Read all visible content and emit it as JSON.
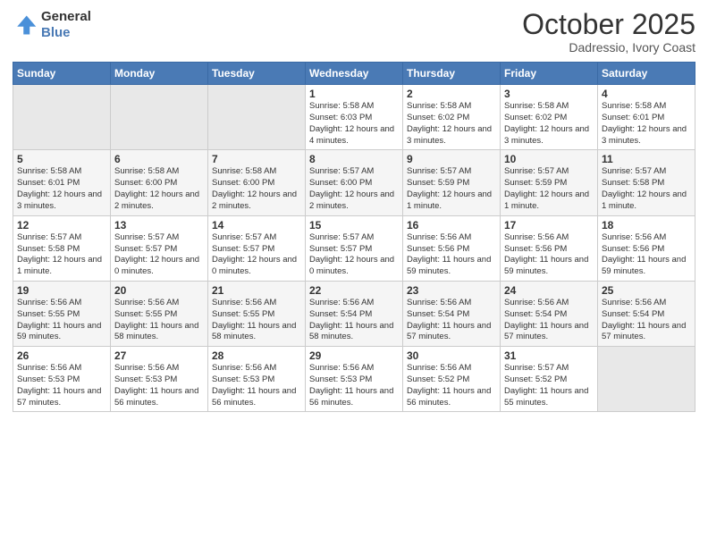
{
  "logo": {
    "line1": "General",
    "line2": "Blue"
  },
  "header": {
    "title": "October 2025",
    "subtitle": "Dadressio, Ivory Coast"
  },
  "weekdays": [
    "Sunday",
    "Monday",
    "Tuesday",
    "Wednesday",
    "Thursday",
    "Friday",
    "Saturday"
  ],
  "weeks": [
    [
      {
        "num": "",
        "info": ""
      },
      {
        "num": "",
        "info": ""
      },
      {
        "num": "",
        "info": ""
      },
      {
        "num": "1",
        "info": "Sunrise: 5:58 AM\nSunset: 6:03 PM\nDaylight: 12 hours and 4 minutes."
      },
      {
        "num": "2",
        "info": "Sunrise: 5:58 AM\nSunset: 6:02 PM\nDaylight: 12 hours and 3 minutes."
      },
      {
        "num": "3",
        "info": "Sunrise: 5:58 AM\nSunset: 6:02 PM\nDaylight: 12 hours and 3 minutes."
      },
      {
        "num": "4",
        "info": "Sunrise: 5:58 AM\nSunset: 6:01 PM\nDaylight: 12 hours and 3 minutes."
      }
    ],
    [
      {
        "num": "5",
        "info": "Sunrise: 5:58 AM\nSunset: 6:01 PM\nDaylight: 12 hours and 3 minutes."
      },
      {
        "num": "6",
        "info": "Sunrise: 5:58 AM\nSunset: 6:00 PM\nDaylight: 12 hours and 2 minutes."
      },
      {
        "num": "7",
        "info": "Sunrise: 5:58 AM\nSunset: 6:00 PM\nDaylight: 12 hours and 2 minutes."
      },
      {
        "num": "8",
        "info": "Sunrise: 5:57 AM\nSunset: 6:00 PM\nDaylight: 12 hours and 2 minutes."
      },
      {
        "num": "9",
        "info": "Sunrise: 5:57 AM\nSunset: 5:59 PM\nDaylight: 12 hours and 1 minute."
      },
      {
        "num": "10",
        "info": "Sunrise: 5:57 AM\nSunset: 5:59 PM\nDaylight: 12 hours and 1 minute."
      },
      {
        "num": "11",
        "info": "Sunrise: 5:57 AM\nSunset: 5:58 PM\nDaylight: 12 hours and 1 minute."
      }
    ],
    [
      {
        "num": "12",
        "info": "Sunrise: 5:57 AM\nSunset: 5:58 PM\nDaylight: 12 hours and 1 minute."
      },
      {
        "num": "13",
        "info": "Sunrise: 5:57 AM\nSunset: 5:57 PM\nDaylight: 12 hours and 0 minutes."
      },
      {
        "num": "14",
        "info": "Sunrise: 5:57 AM\nSunset: 5:57 PM\nDaylight: 12 hours and 0 minutes."
      },
      {
        "num": "15",
        "info": "Sunrise: 5:57 AM\nSunset: 5:57 PM\nDaylight: 12 hours and 0 minutes."
      },
      {
        "num": "16",
        "info": "Sunrise: 5:56 AM\nSunset: 5:56 PM\nDaylight: 11 hours and 59 minutes."
      },
      {
        "num": "17",
        "info": "Sunrise: 5:56 AM\nSunset: 5:56 PM\nDaylight: 11 hours and 59 minutes."
      },
      {
        "num": "18",
        "info": "Sunrise: 5:56 AM\nSunset: 5:56 PM\nDaylight: 11 hours and 59 minutes."
      }
    ],
    [
      {
        "num": "19",
        "info": "Sunrise: 5:56 AM\nSunset: 5:55 PM\nDaylight: 11 hours and 59 minutes."
      },
      {
        "num": "20",
        "info": "Sunrise: 5:56 AM\nSunset: 5:55 PM\nDaylight: 11 hours and 58 minutes."
      },
      {
        "num": "21",
        "info": "Sunrise: 5:56 AM\nSunset: 5:55 PM\nDaylight: 11 hours and 58 minutes."
      },
      {
        "num": "22",
        "info": "Sunrise: 5:56 AM\nSunset: 5:54 PM\nDaylight: 11 hours and 58 minutes."
      },
      {
        "num": "23",
        "info": "Sunrise: 5:56 AM\nSunset: 5:54 PM\nDaylight: 11 hours and 57 minutes."
      },
      {
        "num": "24",
        "info": "Sunrise: 5:56 AM\nSunset: 5:54 PM\nDaylight: 11 hours and 57 minutes."
      },
      {
        "num": "25",
        "info": "Sunrise: 5:56 AM\nSunset: 5:54 PM\nDaylight: 11 hours and 57 minutes."
      }
    ],
    [
      {
        "num": "26",
        "info": "Sunrise: 5:56 AM\nSunset: 5:53 PM\nDaylight: 11 hours and 57 minutes."
      },
      {
        "num": "27",
        "info": "Sunrise: 5:56 AM\nSunset: 5:53 PM\nDaylight: 11 hours and 56 minutes."
      },
      {
        "num": "28",
        "info": "Sunrise: 5:56 AM\nSunset: 5:53 PM\nDaylight: 11 hours and 56 minutes."
      },
      {
        "num": "29",
        "info": "Sunrise: 5:56 AM\nSunset: 5:53 PM\nDaylight: 11 hours and 56 minutes."
      },
      {
        "num": "30",
        "info": "Sunrise: 5:56 AM\nSunset: 5:52 PM\nDaylight: 11 hours and 56 minutes."
      },
      {
        "num": "31",
        "info": "Sunrise: 5:57 AM\nSunset: 5:52 PM\nDaylight: 11 hours and 55 minutes."
      },
      {
        "num": "",
        "info": ""
      }
    ]
  ]
}
